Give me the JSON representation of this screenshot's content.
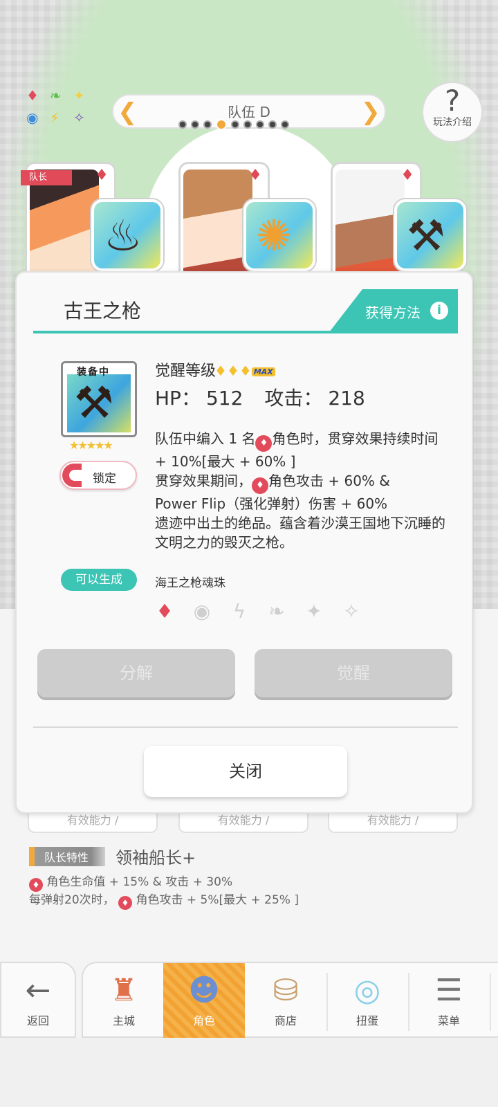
{
  "team": {
    "name": "队伍 D",
    "page_count": 9,
    "current_page": 4
  },
  "help": {
    "label": "玩法介绍"
  },
  "party": {
    "captain_tag": "队长",
    "suit_color": "#e24b5b"
  },
  "modal": {
    "title": "古王之枪",
    "acquire_label": "获得方法",
    "equipped_label": "装备中",
    "rarity_stars": "★★★★★",
    "lock_label": "锁定",
    "awaken_label": "觉醒等级",
    "awaken_gems": "♦♦♦",
    "max_label": "MAX",
    "hp_label": "HP：",
    "hp_value": "512",
    "atk_label": "攻击：",
    "atk_value": "218",
    "desc_line1": "队伍中编入 1 名",
    "desc_line1b": "角色时，贯穿效果持续时间 + 10%[最大 + 60% ]",
    "desc_line2": "贯穿效果期间，",
    "desc_line2b": "角色攻击 + 60% &",
    "desc_line3": "Power Flip（强化弹射）伤害 + 60%",
    "desc_line4": "遗迹中出土的绝品。蕴含着沙漠王国地下沉睡的文明之力的毁灭之枪。",
    "craft_label": "可以生成",
    "craft_name": "海王之枪魂珠",
    "decompose_label": "分解",
    "awaken_button": "觉醒",
    "close_label": "关闭"
  },
  "stat_rows": [
    "有效能力 ∕",
    "有效能力 ∕",
    "有效能力 ∕"
  ],
  "leader_trait": {
    "tag": "队长特性",
    "name": "领袖船长+",
    "desc_a": "角色生命值 + 15% & 攻击 + 30%",
    "desc_b_pre": "每弹射20次时，",
    "desc_b_post": "角色攻击 + 5%[最大 + 25% ]"
  },
  "nav": {
    "back": "返回",
    "items": [
      "主城",
      "角色",
      "商店",
      "扭蛋",
      "菜单"
    ],
    "active": "角色"
  }
}
